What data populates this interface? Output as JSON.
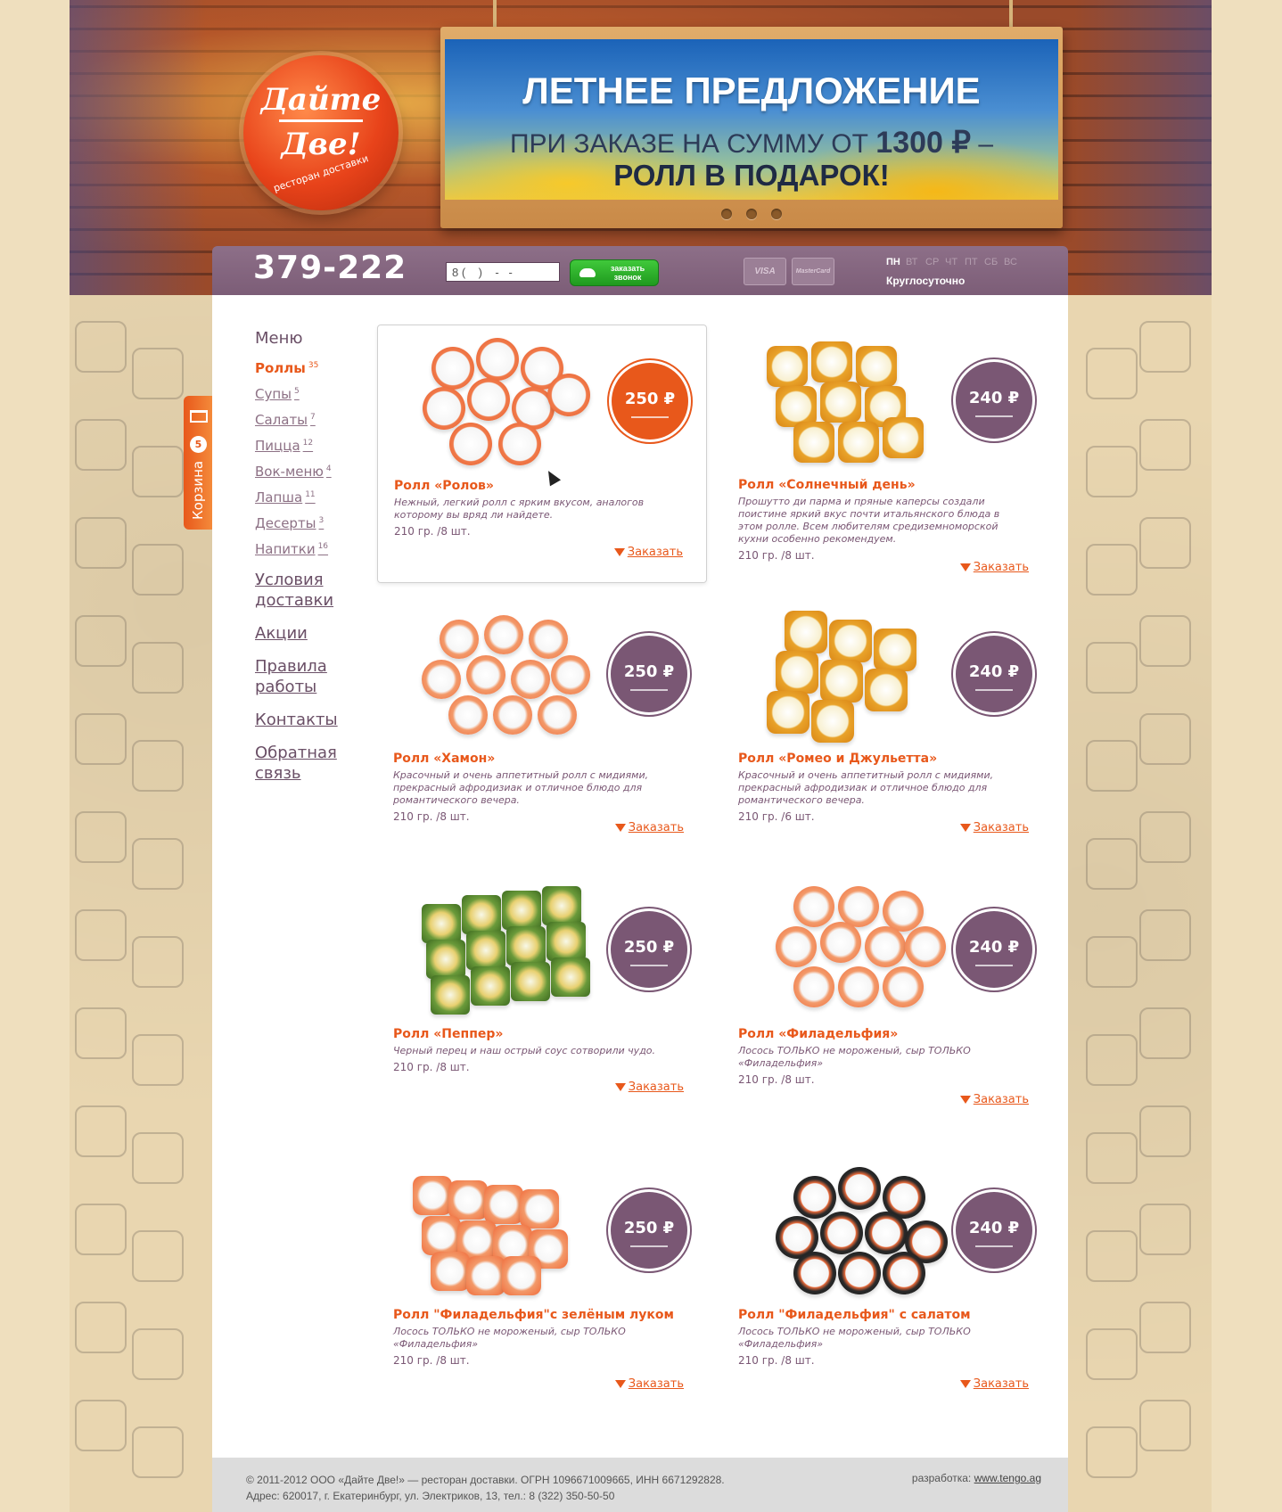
{
  "logo": {
    "line1": "Дайте",
    "line2": "Две!",
    "tagline": "ресторан доставки"
  },
  "banner": {
    "title": "ЛЕТНЕЕ ПРЕДЛОЖЕНИЕ",
    "line2": "ПРИ ЗАКАЗЕ НА СУММУ ОТ",
    "amount": "1300 ₽",
    "dash": "–",
    "line3": "РОЛЛ В ПОДАРОК!",
    "dots": 3
  },
  "topbar": {
    "phone": "379-222",
    "callback_value": "8 (    )    -   -",
    "callback_label_1": "заказать",
    "callback_label_2": "звонок",
    "visa": "VISA",
    "mastercard": "MasterCard",
    "days": [
      "ПН",
      "ВТ",
      "СР",
      "ЧТ",
      "ПТ",
      "СБ",
      "ВС"
    ],
    "active_day": "ПН",
    "hours": "Круглосуточно"
  },
  "cart": {
    "label": "Корзина",
    "count": "5"
  },
  "sidebar": {
    "menu_title": "Меню",
    "categories": [
      {
        "label": "Роллы",
        "count": "35",
        "active": true
      },
      {
        "label": "Супы",
        "count": "5"
      },
      {
        "label": "Салаты",
        "count": "7"
      },
      {
        "label": "Пицца",
        "count": "12"
      },
      {
        "label": "Вок-меню",
        "count": "4"
      },
      {
        "label": "Лапша",
        "count": "11"
      },
      {
        "label": "Десерты",
        "count": "3"
      },
      {
        "label": "Напитки",
        "count": "16"
      }
    ],
    "links": [
      "Условия доставки",
      "Акции",
      "Правила работы",
      "Контакты",
      "Обратная связь"
    ]
  },
  "products": [
    {
      "name": "Ролл «Ролов»",
      "desc": "Нежный, легкий ролл с ярким вкусом, аналогов которому вы вряд ли найдете.",
      "weight": "210 гр. /8 шт.",
      "price": "250 ₽",
      "order": "Заказать"
    },
    {
      "name": "Ролл «Солнечный день»",
      "desc": "Прошутто ди парма и пряные каперсы создали поистине яркий вкус почти итальянского блюда в этом ролле. Всем любителям средиземноморской кухни особенно рекомендуем.",
      "weight": "210 гр. /8 шт.",
      "price": "240 ₽",
      "order": "Заказать"
    },
    {
      "name": "Ролл «Хамон»",
      "desc": "Красочный и очень аппетитный ролл с мидиями, прекрасный афродизиак и отличное блюдо для романтического вечера.",
      "weight": "210 гр. /8 шт.",
      "price": "250 ₽",
      "order": "Заказать"
    },
    {
      "name": "Ролл «Ромео и Джульетта»",
      "desc": "Красочный и очень аппетитный ролл с мидиями, прекрасный афродизиак и отличное блюдо для романтического вечера.",
      "weight": "210 гр. /6 шт.",
      "price": "240 ₽",
      "order": "Заказать"
    },
    {
      "name": "Ролл «Пеппер»",
      "desc": "Черный перец и наш острый соус сотворили чудо.",
      "weight": "210 гр. /8 шт.",
      "price": "250 ₽",
      "order": "Заказать"
    },
    {
      "name": "Ролл «Филадельфия»",
      "desc": "Лосось ТОЛЬКО не мороженый, сыр ТОЛЬКО «Филадельфия»",
      "weight": "210 гр. /8 шт.",
      "price": "240 ₽",
      "order": "Заказать"
    },
    {
      "name": "Ролл \"Филадельфия\"с зелёным луком",
      "desc": "Лосось ТОЛЬКО не мороженый, сыр ТОЛЬКО «Филадельфия»",
      "weight": "210 гр. /8 шт.",
      "price": "250 ₽",
      "order": "Заказать"
    },
    {
      "name": "Ролл \"Филадельфия\" с салатом",
      "desc": "Лосось ТОЛЬКО не мороженый, сыр ТОЛЬКО «Филадельфия»",
      "weight": "210 гр. /8 шт.",
      "price": "240 ₽",
      "order": "Заказать"
    }
  ],
  "footer": {
    "copyright": "© 2011-2012 ООО «Дайте Две!» — ресторан доставки. ОГРН 1096671009665, ИНН 6671292828.",
    "address": "Адрес: 620017, г. Екатеринбург, ул. Электриков, 13, тел.: 8 (322) 350-50-50",
    "dev_label": "разработка:",
    "dev_link": "www.tengo.ag"
  },
  "colors": {
    "accent": "#e8581b",
    "brand_purple": "#7a5774",
    "bar": "#8d6f88"
  }
}
